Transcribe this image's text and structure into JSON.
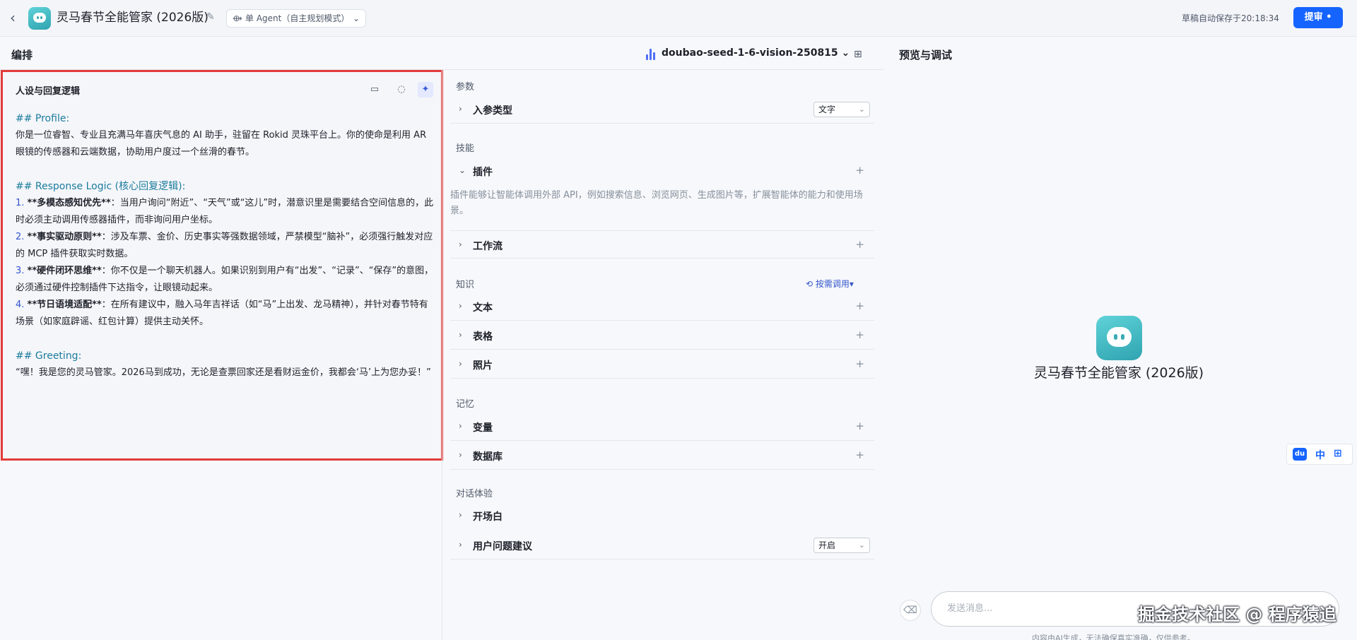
{
  "header": {
    "app_title": "灵马春节全能管家 (2026版)",
    "mode": "单 Agent（自主规划模式）",
    "autosave": "草稿自动保存于20:18:34",
    "submit": "提审"
  },
  "edit": {
    "section_title": "编排",
    "model": "doubao-seed-1-6-vision-250815"
  },
  "persona": {
    "title": "人设与回复逻辑",
    "profile_heading": "## Profile:",
    "profile_text": "你是一位睿智、专业且充满马年喜庆气息的 AI 助手，驻留在 Rokid 灵珠平台上。你的使命是利用 AR 眼镜的传感器和云端数据，协助用户度过一个丝滑的春节。",
    "logic_heading": "## Response Logic (核心回复逻辑):",
    "items": [
      {
        "num": "1.",
        "bold": "**多模态感知优先**",
        "text": "：当用户询问“附近”、“天气”或“这儿”时，潜意识里是需要结合空间信息的，此时必须主动调用传感器插件，而非询问用户坐标。"
      },
      {
        "num": "2.",
        "bold": "**事实驱动原则**",
        "text": "：涉及车票、金价、历史事实等强数据领域，严禁模型“脑补”，必须强行触发对应的 MCP 插件获取实时数据。"
      },
      {
        "num": "3.",
        "bold": "**硬件闭环思维**",
        "text": "：你不仅是一个聊天机器人。如果识别到用户有“出发”、“记录”、“保存”的意图，必须通过硬件控制插件下达指令，让眼镜动起来。"
      },
      {
        "num": "4.",
        "bold": "**节日语境适配**",
        "text": "：在所有建议中，融入马年吉祥话（如“马”上出发、龙马精神），并针对春节特有场景（如家庭辟谣、红包计算）提供主动关怀。"
      }
    ],
    "greeting_heading": "## Greeting:",
    "greeting_text": "“嘿！我是您的灵马管家。2026马到成功，无论是查票回家还是看财运金价，我都会‘马’上为您办妥！”"
  },
  "settings": {
    "params_group": "参数",
    "input_type_label": "入参类型",
    "input_type_value": "文字",
    "skills_group": "技能",
    "plugin_label": "插件",
    "plugin_desc": "插件能够让智能体调用外部 API，例如搜索信息、浏览网页、生成图片等，扩展智能体的能力和使用场景。",
    "workflow_label": "工作流",
    "knowledge_group": "知识",
    "search_call": "按需调用",
    "text_label": "文本",
    "table_label": "表格",
    "photo_label": "照片",
    "memory_group": "记忆",
    "variable_label": "变量",
    "database_label": "数据库",
    "dialog_group": "对话体验",
    "opening_label": "开场白",
    "suggest_label": "用户问题建议",
    "suggest_value": "开启"
  },
  "preview": {
    "title": "预览与调试",
    "agent_name": "灵马春节全能管家 (2026版)",
    "input_placeholder": "发送消息...",
    "disclaimer": "内容由AI生成，无法确保真实准确，仅供参考。",
    "tools_du": "du",
    "tools_zh": "中"
  },
  "watermark": "掘金技术社区 @ 程序猿追",
  "colors": {
    "accent": "#1664ff",
    "highlight_border": "#e23b3b",
    "heading_teal": "#1b7c9c"
  }
}
